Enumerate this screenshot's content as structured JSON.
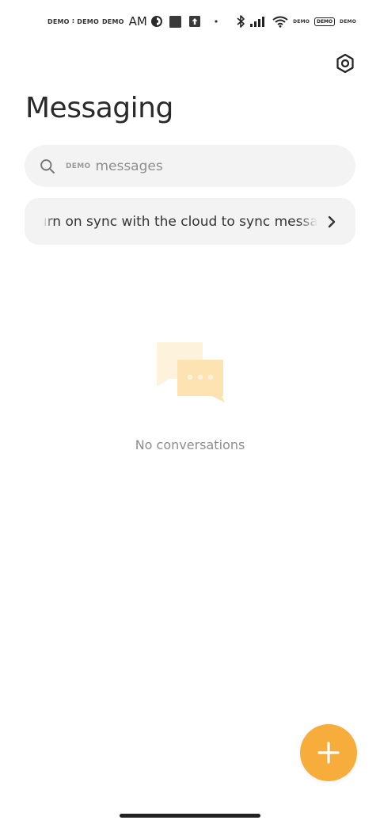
{
  "status_bar": {
    "demo_tags_left": [
      "DEMO",
      "DEMO",
      "DEMO"
    ],
    "clock": "AM",
    "demo_tags_right": [
      "DEMO",
      "DEMO",
      "DEMO"
    ],
    "icons": [
      "app-circle-icon",
      "square-icon",
      "upload-icon",
      "dot-icon",
      "bluetooth-icon",
      "signal-icon",
      "wifi-icon",
      "battery-icon"
    ]
  },
  "header": {
    "title": "Messaging",
    "settings_icon": "gear-icon"
  },
  "search": {
    "demo_label": "DEMO",
    "placeholder": "messages"
  },
  "sync_banner": {
    "text": "Turn on sync with the cloud to sync messages"
  },
  "empty_state": {
    "text": "No conversations"
  },
  "fab": {
    "icon": "plus-icon"
  },
  "colors": {
    "accent": "#f6ad3c",
    "illustration_back": "#fdf2dc",
    "illustration_front": "#fce3b1",
    "surface": "#f3f3f3"
  }
}
